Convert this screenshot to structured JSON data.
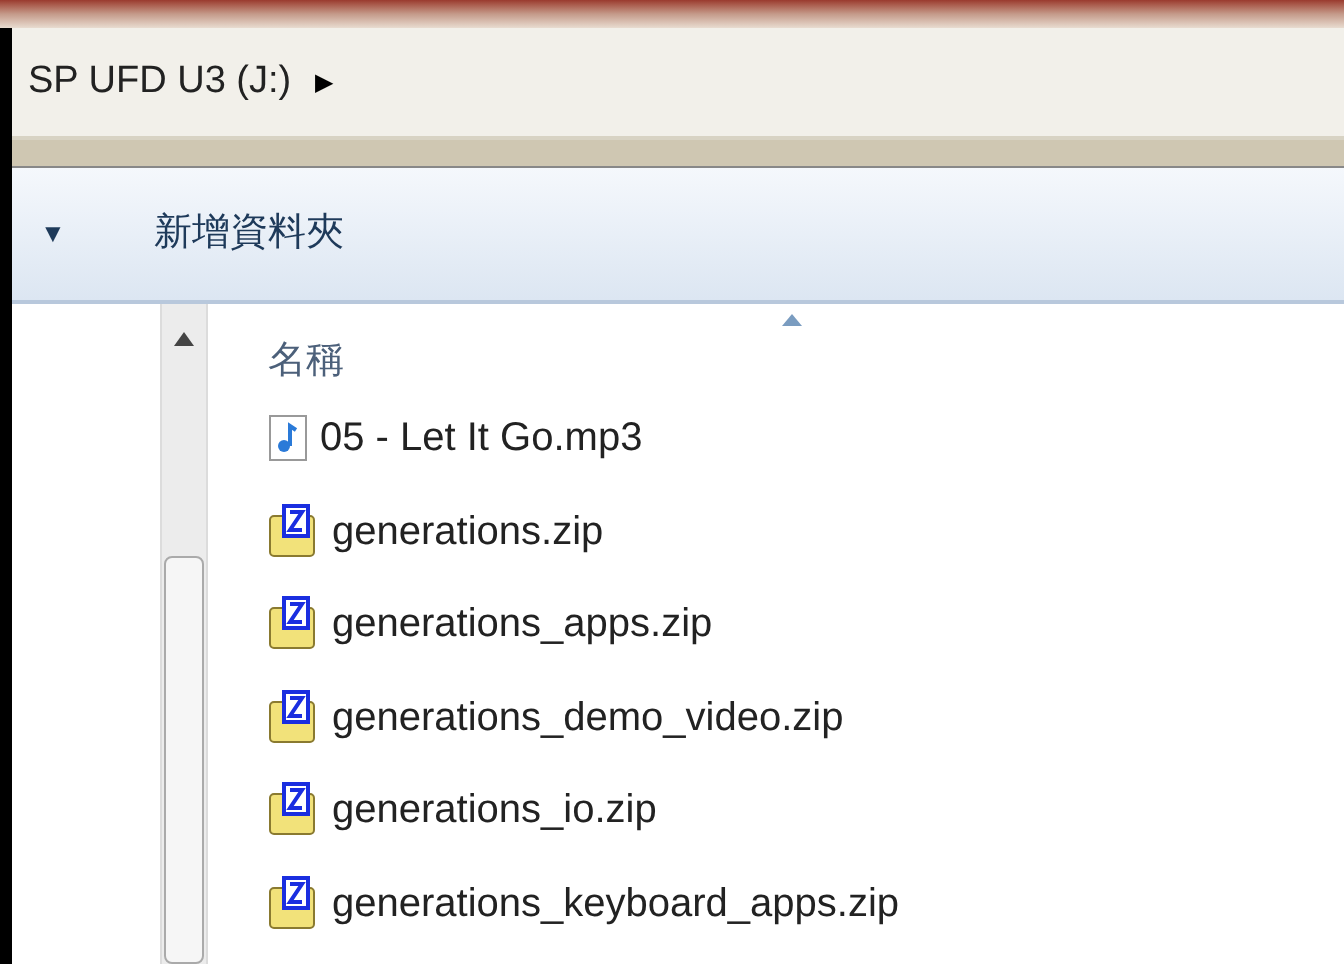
{
  "address_bar": {
    "path": "SP UFD U3 (J:)",
    "chevron": "▶"
  },
  "toolbar": {
    "organize_arrow": "▼",
    "new_folder": "新增資料夾"
  },
  "file_list": {
    "column_header": "名稱",
    "sorted_ascending": true,
    "files": [
      {
        "name": "05 - Let It Go.mp3",
        "kind": "audio"
      },
      {
        "name": "generations.zip",
        "kind": "zip"
      },
      {
        "name": "generations_apps.zip",
        "kind": "zip"
      },
      {
        "name": "generations_demo_video.zip",
        "kind": "zip"
      },
      {
        "name": "generations_io.zip",
        "kind": "zip"
      },
      {
        "name": "generations_keyboard_apps.zip",
        "kind": "zip"
      }
    ]
  }
}
